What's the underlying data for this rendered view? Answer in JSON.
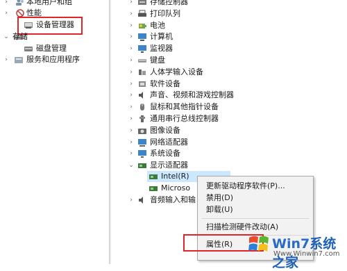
{
  "left_tree": {
    "local_users": "本地用户和组",
    "performance": "性能",
    "device_manager": "设备管理器",
    "storage": "存储",
    "disk_management": "磁盘管理",
    "services_apps": "服务和应用程序"
  },
  "device_tree": {
    "items": [
      {
        "label": "存储控制器",
        "icon": "storage-controller-icon"
      },
      {
        "label": "打印队列",
        "icon": "printer-icon"
      },
      {
        "label": "电池",
        "icon": "battery-icon"
      },
      {
        "label": "计算机",
        "icon": "computer-icon"
      },
      {
        "label": "监视器",
        "icon": "monitor-icon"
      },
      {
        "label": "键盘",
        "icon": "keyboard-icon"
      },
      {
        "label": "人体学输入设备",
        "icon": "hid-icon"
      },
      {
        "label": "软件设备",
        "icon": "software-device-icon"
      },
      {
        "label": "声音、视频和游戏控制器",
        "icon": "speaker-icon"
      },
      {
        "label": "鼠标和其他指针设备",
        "icon": "mouse-icon"
      },
      {
        "label": "通用串行总线控制器",
        "icon": "usb-icon"
      },
      {
        "label": "图像设备",
        "icon": "camera-icon"
      },
      {
        "label": "网络适配器",
        "icon": "network-icon"
      },
      {
        "label": "系统设备",
        "icon": "system-device-icon"
      },
      {
        "label": "显示适配器",
        "icon": "display-adapter-icon"
      }
    ],
    "display_children": [
      {
        "label": "Intel(R)",
        "icon": "display-card-icon"
      },
      {
        "label": "Microso",
        "icon": "display-card-icon"
      }
    ],
    "audio_io": "音频输入和输"
  },
  "context_menu": {
    "update_driver": "更新驱动程序软件(P)...",
    "disable": "禁用(D)",
    "uninstall": "卸载(U)",
    "scan": "扫描检测硬件改动(A)",
    "properties": "属性(R)"
  },
  "watermark": {
    "brand_latin": "Win7",
    "brand_zh": "系统之家",
    "url": "Www.Winwin7.com"
  },
  "colors": {
    "highlight_red": "#e0242b",
    "selection_bg": "#cce8ff",
    "brand_blue": "#2b6bc8"
  }
}
